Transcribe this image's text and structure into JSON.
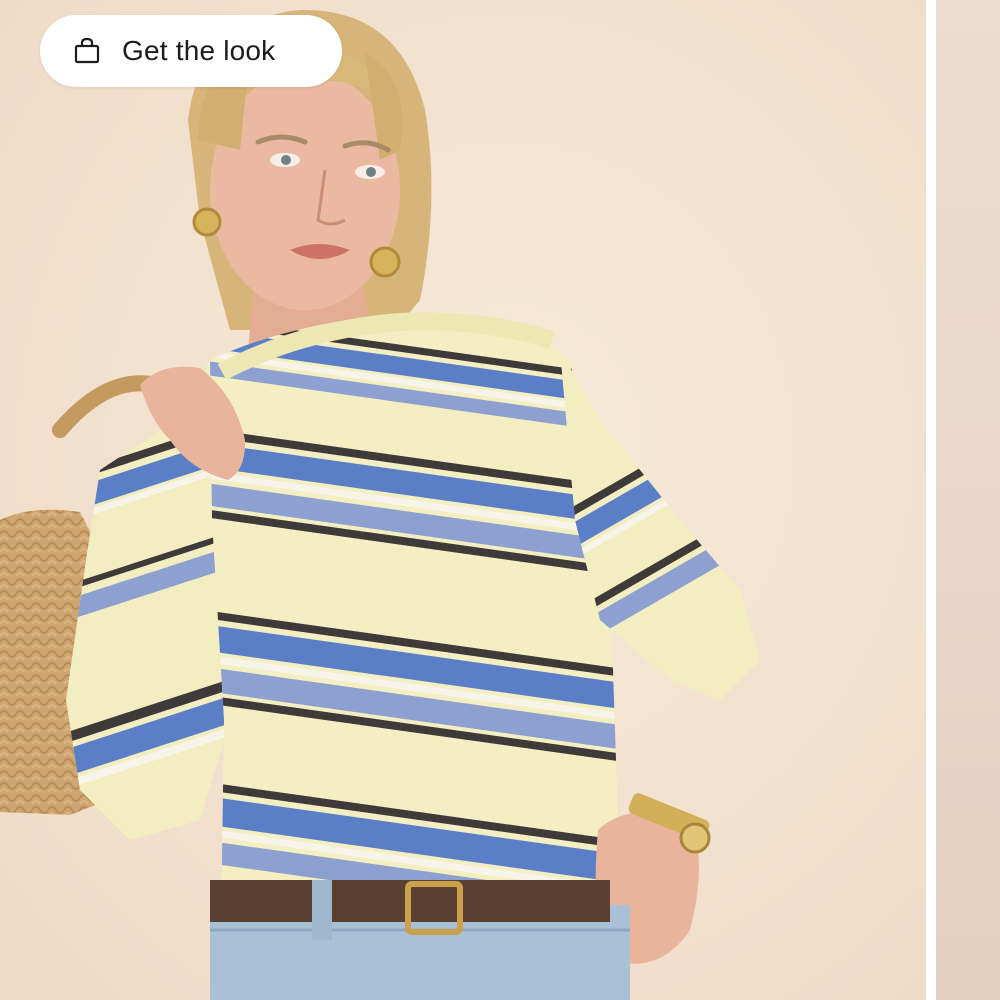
{
  "cta": {
    "label": "Get the look",
    "icon": "shopping-bag-icon"
  },
  "media": {
    "backdrop_color": "#f2e0d0",
    "sweater_base_color": "#f3efc2",
    "stripe_colors": [
      "#3f3a3a",
      "#5a7fc6",
      "#8ea0d0",
      "#f7f4ea"
    ],
    "denim_color": "#a9c0d6",
    "belt_color": "#5a4030",
    "bag_color": "#cfa671",
    "skin_color": "#e8b59c",
    "hair_color": "#d8b77b"
  },
  "carousel": {
    "next_slide_peek_color": "#e9d6c8"
  }
}
